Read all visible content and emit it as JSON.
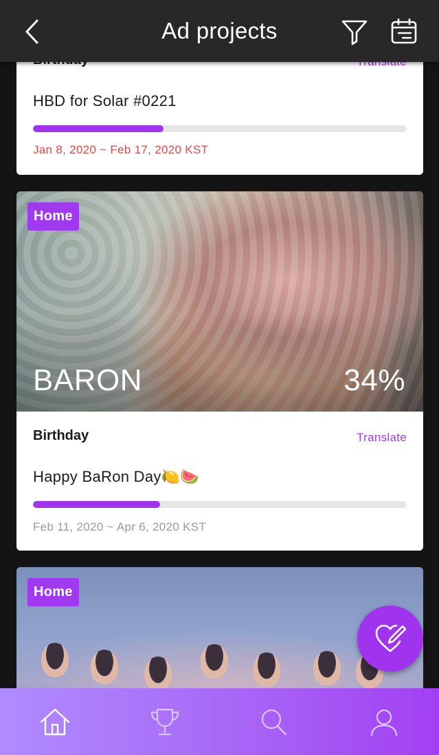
{
  "header": {
    "title": "Ad projects",
    "icons": {
      "back": "chevron-left-icon",
      "filter": "filter-icon",
      "calendar": "calendar-icon"
    }
  },
  "cards": [
    {
      "category": "Birthday",
      "translate": "Translate",
      "title": "HBD for Solar #0221",
      "progress": 0.35,
      "dates": "Jan 8, 2020 ~ Feb 17, 2020 KST",
      "dates_color": "#e24a4a"
    },
    {
      "badge": "Home",
      "name": "BARON",
      "percent": "34%",
      "progress": 0.34,
      "category": "Birthday",
      "translate": "Translate",
      "title": "Happy BaRon Day🍋🍉",
      "dates": "Feb 11, 2020 ~ Apr 6, 2020 KST"
    },
    {
      "badge": "Home"
    }
  ],
  "fab": {
    "icon": "heart-pen-icon"
  },
  "bottom_nav": {
    "items": [
      {
        "icon": "home-icon"
      },
      {
        "icon": "trophy-icon"
      },
      {
        "icon": "search-icon"
      },
      {
        "icon": "profile-icon"
      }
    ]
  },
  "colors": {
    "accent": "#a033ee",
    "header_bg": "#282828",
    "alert_red": "#e24a4a",
    "nav_gradient_start": "#b08bff",
    "nav_gradient_end": "#a240f3"
  }
}
